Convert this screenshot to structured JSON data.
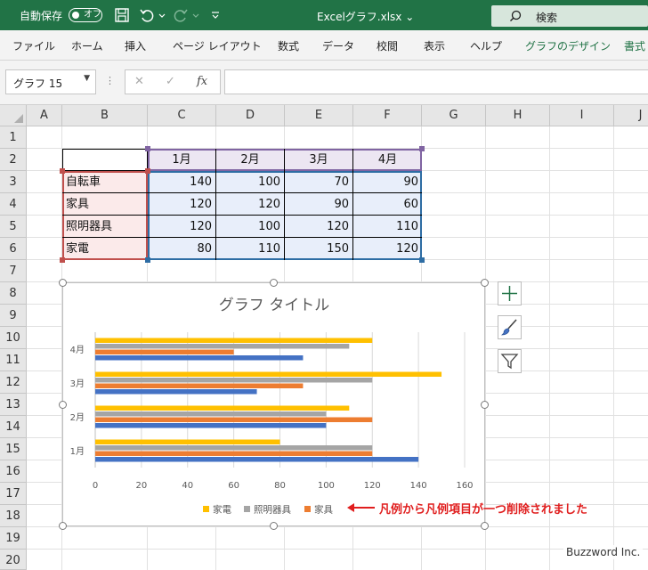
{
  "titlebar": {
    "autosave_label": "自動保存",
    "autosave_state": "オフ",
    "file_name": "Excelグラフ.xlsx",
    "search_label": "検索"
  },
  "ribbon": {
    "tabs": [
      "ファイル",
      "ホーム",
      "挿入",
      "ページ レイアウト",
      "数式",
      "データ",
      "校閲",
      "表示",
      "ヘルプ",
      "グラフのデザイン",
      "書式"
    ]
  },
  "formula_bar": {
    "name_box": "グラフ 15",
    "formula": ""
  },
  "sheet": {
    "columns": [
      "A",
      "B",
      "C",
      "D",
      "E",
      "F",
      "G",
      "H",
      "I",
      "J"
    ],
    "rows": [
      "1",
      "2",
      "3",
      "4",
      "5",
      "6",
      "7",
      "8",
      "9",
      "10",
      "11",
      "12",
      "13",
      "14",
      "15",
      "16",
      "17",
      "18",
      "19",
      "20"
    ]
  },
  "table": {
    "headers": [
      "1月",
      "2月",
      "3月",
      "4月"
    ],
    "rows": [
      {
        "label": "自転車",
        "values": [
          "140",
          "100",
          "70",
          "90"
        ]
      },
      {
        "label": "家具",
        "values": [
          "120",
          "120",
          "90",
          "60"
        ]
      },
      {
        "label": "照明器具",
        "values": [
          "120",
          "100",
          "120",
          "110"
        ]
      },
      {
        "label": "家電",
        "values": [
          "80",
          "110",
          "150",
          "120"
        ]
      }
    ]
  },
  "chart_data": {
    "type": "bar",
    "orientation": "horizontal",
    "title": "グラフ タイトル",
    "categories": [
      "1月",
      "2月",
      "3月",
      "4月"
    ],
    "series": [
      {
        "name": "自転車",
        "values": [
          140,
          100,
          70,
          90
        ],
        "color": "#4472c4"
      },
      {
        "name": "家具",
        "values": [
          120,
          120,
          90,
          60
        ],
        "color": "#ed7d31"
      },
      {
        "name": "照明器具",
        "values": [
          120,
          100,
          120,
          110
        ],
        "color": "#a5a5a5"
      },
      {
        "name": "家電",
        "values": [
          80,
          110,
          150,
          120
        ],
        "color": "#ffc000"
      }
    ],
    "legend_entries": [
      "家電",
      "照明器具",
      "家具"
    ],
    "legend_position": "bottom",
    "xlim": [
      0,
      160
    ],
    "x_ticks": [
      0,
      20,
      40,
      60,
      80,
      100,
      120,
      140,
      160
    ],
    "grid": true
  },
  "annotation": {
    "text": "凡例から凡例項目が一つ削除されました",
    "color": "#e01e1e"
  },
  "watermark": "Buzzword Inc.",
  "colors": {
    "excel_green": "#217346"
  }
}
